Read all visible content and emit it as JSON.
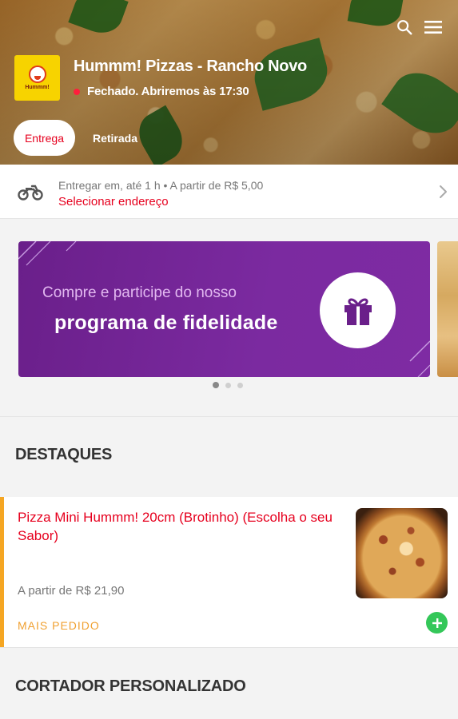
{
  "header": {
    "store_name": "Hummm! Pizzas - Rancho Novo",
    "status_text": "Fechado. Abriremos às 17:30",
    "status_color": "#ff1e3c",
    "logo_text": "Hummm!",
    "icons": {
      "search": "search-icon",
      "menu": "hamburger-menu-icon"
    },
    "tabs": [
      {
        "label": "Entrega",
        "active": true
      },
      {
        "label": "Retirada",
        "active": false
      }
    ]
  },
  "delivery": {
    "icon": "motorcycle-icon",
    "info": "Entregar em, até 1 h  •  A partir de R$ 5,00",
    "action": "Selecionar endereço",
    "accent": "#e6001e"
  },
  "banner": {
    "line1": "Compre e participe do nosso",
    "line2": "programa de fidelidade",
    "icon": "gift-icon",
    "color": "#7b2aa0",
    "pages": 3,
    "active_page": 1
  },
  "sections": {
    "destaques": {
      "title": "DESTAQUES",
      "product": {
        "name": "Pizza Mini Hummm! 20cm (Brotinho) (Escolha o seu Sabor)",
        "price": "A partir de R$ 21,90",
        "tag": "MAIS PEDIDO",
        "add_icon": "plus-icon"
      }
    },
    "cortador": {
      "title": "CORTADOR PERSONALIZADO"
    }
  }
}
